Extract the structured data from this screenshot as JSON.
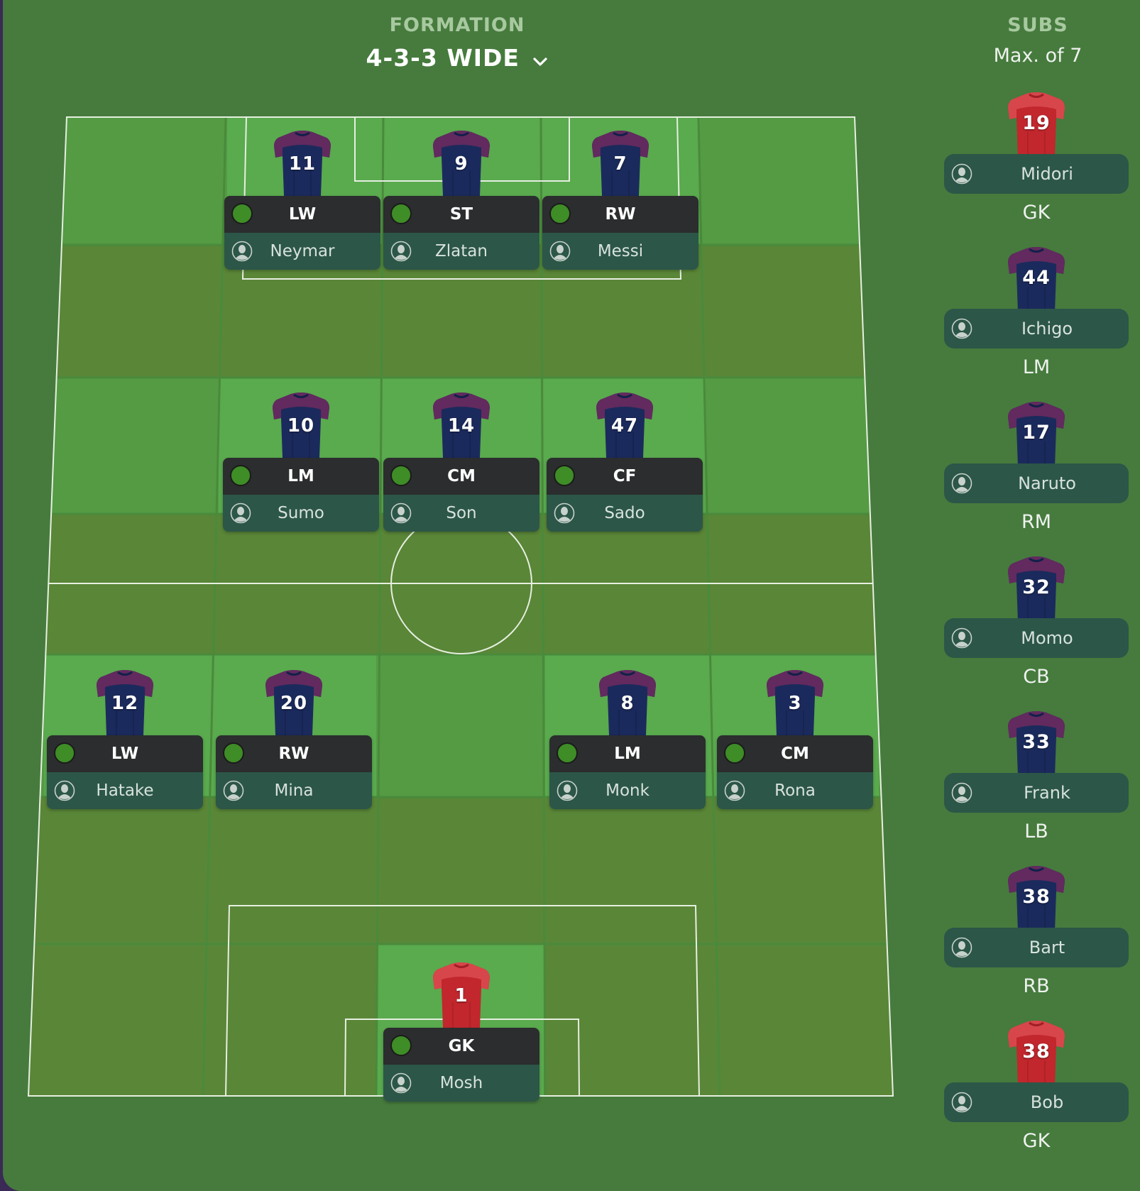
{
  "formation": {
    "heading": "FORMATION",
    "value": "4-3-3 WIDE"
  },
  "subs": {
    "heading": "SUBS",
    "subtitle": "Max. of 7"
  },
  "colors": {
    "outfield_kit": "#1b2a5c",
    "keeper_kit": "#c1272d",
    "ready_dot": "#3e8d26"
  },
  "icons": {
    "dropdown": "chevron-down-icon",
    "player": "player-silhouette-icon",
    "status": "status-dot-icon"
  },
  "lineup": [
    {
      "number": "11",
      "position": "LW",
      "name": "Neymar",
      "kit": "outfield"
    },
    {
      "number": "9",
      "position": "ST",
      "name": "Zlatan",
      "kit": "outfield"
    },
    {
      "number": "7",
      "position": "RW",
      "name": "Messi",
      "kit": "outfield"
    },
    {
      "number": "10",
      "position": "LM",
      "name": "Sumo",
      "kit": "outfield"
    },
    {
      "number": "14",
      "position": "CM",
      "name": "Son",
      "kit": "outfield"
    },
    {
      "number": "47",
      "position": "CF",
      "name": "Sado",
      "kit": "outfield"
    },
    {
      "number": "12",
      "position": "LW",
      "name": "Hatake",
      "kit": "outfield"
    },
    {
      "number": "20",
      "position": "RW",
      "name": "Mina",
      "kit": "outfield"
    },
    {
      "number": "8",
      "position": "LM",
      "name": "Monk",
      "kit": "outfield"
    },
    {
      "number": "3",
      "position": "CM",
      "name": "Rona",
      "kit": "outfield"
    },
    {
      "number": "1",
      "position": "GK",
      "name": "Mosh",
      "kit": "keeper"
    }
  ],
  "bench": [
    {
      "number": "19",
      "name": "Midori",
      "position": "GK",
      "kit": "keeper"
    },
    {
      "number": "44",
      "name": "Ichigo",
      "position": "LM",
      "kit": "outfield"
    },
    {
      "number": "17",
      "name": "Naruto",
      "position": "RM",
      "kit": "outfield"
    },
    {
      "number": "32",
      "name": "Momo",
      "position": "CB",
      "kit": "outfield"
    },
    {
      "number": "33",
      "name": "Frank",
      "position": "LB",
      "kit": "outfield"
    },
    {
      "number": "38",
      "name": "Bart",
      "position": "RB",
      "kit": "outfield"
    },
    {
      "number": "38",
      "name": "Bob",
      "position": "GK",
      "kit": "keeper"
    }
  ]
}
